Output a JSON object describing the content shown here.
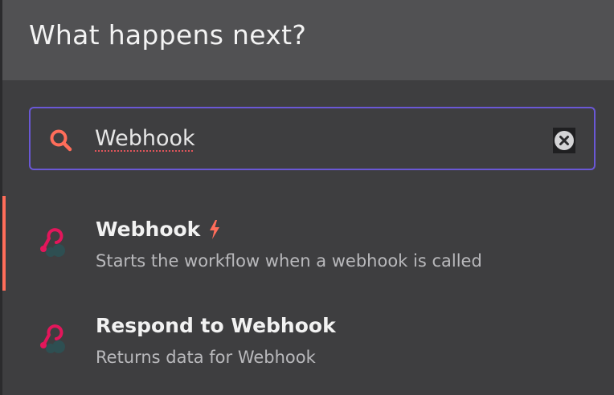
{
  "header": {
    "title": "What happens next?"
  },
  "search": {
    "value": "Webhook",
    "search_icon": "search-icon",
    "clear_icon": "clear-icon"
  },
  "results": [
    {
      "title": "Webhook",
      "description": "Starts the workflow when a webhook is called",
      "icon": "webhook-icon",
      "badge_icon": "lightning-bolt-icon",
      "active": true
    },
    {
      "title": "Respond to Webhook",
      "description": "Returns data for Webhook",
      "icon": "webhook-icon",
      "active": false
    }
  ],
  "colors": {
    "accent": "#ff6d5a",
    "focus_border": "#6a58d6",
    "webhook_pink": "#e3165b"
  }
}
